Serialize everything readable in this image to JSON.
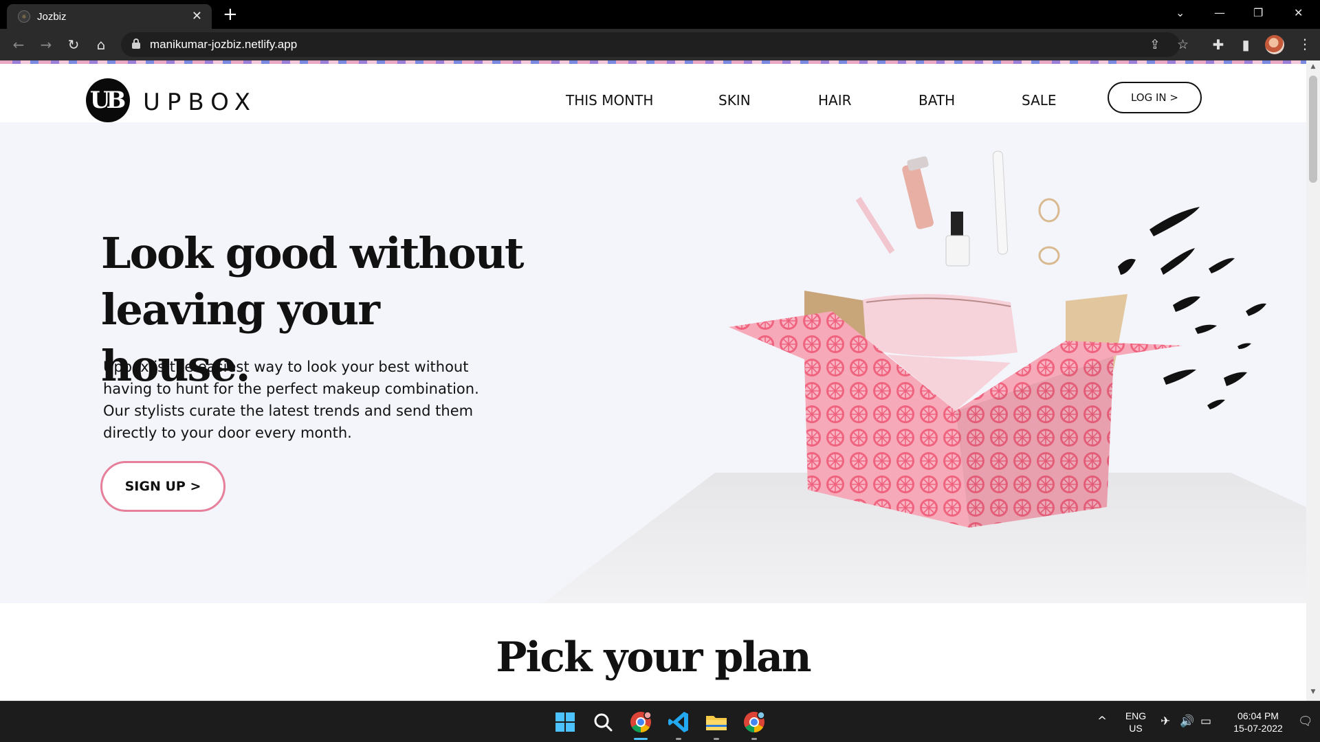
{
  "browser": {
    "tab_title": "Jozbiz",
    "tab_close": "✕",
    "new_tab": "+",
    "window_controls": {
      "tabs_search": "⌄",
      "minimize": "—",
      "restore": "❐",
      "close": "✕"
    },
    "nav": {
      "back": "←",
      "forward": "→",
      "reload": "↻",
      "home": "⌂"
    },
    "url": "manikumar-jozbiz.netlify.app",
    "omnibox_icons": {
      "share": "⇪",
      "bookmark": "☆"
    },
    "toolbar_icons": {
      "extensions": "✚",
      "side_panel": "▮",
      "menu": "⋮"
    }
  },
  "site": {
    "logo_mark": "UB",
    "logo_text": "UPBOX",
    "nav": [
      "THIS MONTH",
      "SKIN",
      "HAIR",
      "BATH",
      "SALE"
    ],
    "login_label": "LOG IN >",
    "hero": {
      "headline": "Look good without leaving your house.",
      "copy": "Upbox is the easiest way to look your best without having to hunt for the perfect makeup combination. Our stylists curate the latest trends and send them directly to your door every month.",
      "cta_label": "SIGN UP >"
    },
    "plans_title": "Pick your plan"
  },
  "colors": {
    "accent_pink": "#e57f9a",
    "hero_bg": "#f4f5fa",
    "box_pink": "#f47f98",
    "ink": "#111111"
  },
  "taskbar": {
    "apps": [
      "windows-start-icon",
      "search-icon",
      "chrome-icon",
      "vscode-icon",
      "file-explorer-icon",
      "chrome-alt-icon"
    ],
    "tray": {
      "chevron": "^",
      "language_line1": "ENG",
      "language_line2": "US",
      "time": "06:04 PM",
      "date": "15-07-2022"
    }
  }
}
